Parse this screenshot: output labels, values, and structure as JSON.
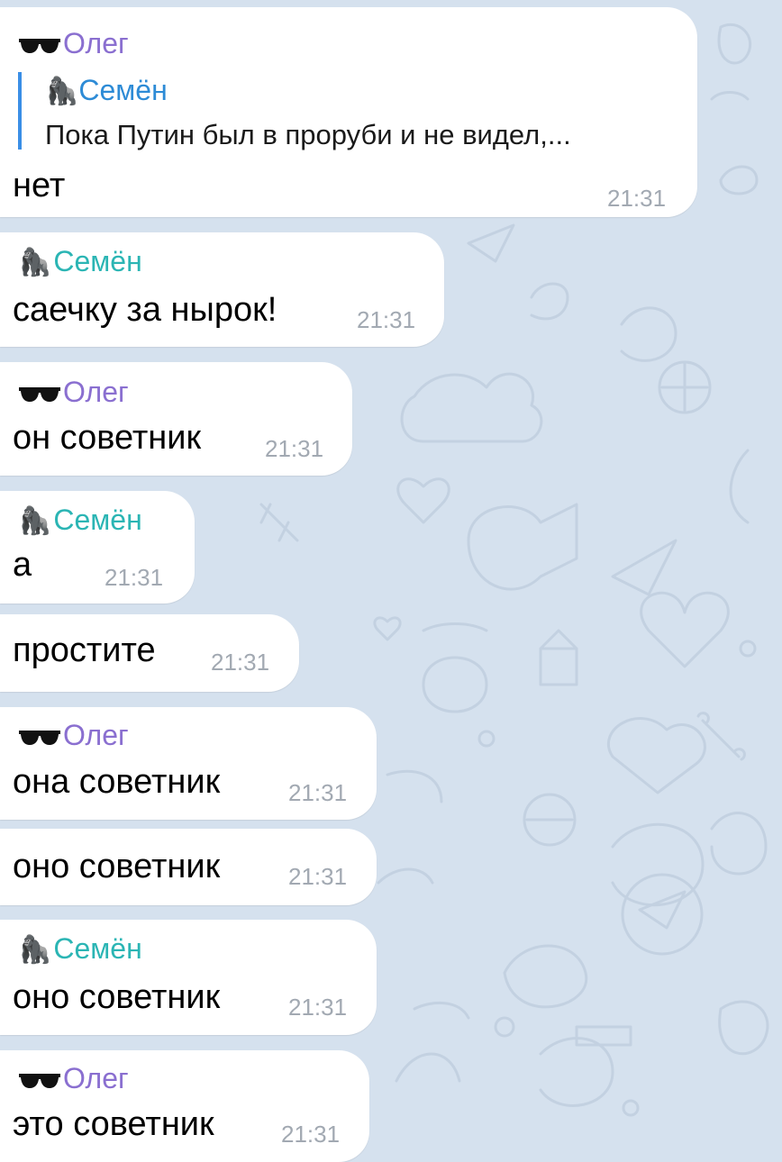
{
  "colors": {
    "background": "#d5e1ee",
    "bubble": "#ffffff",
    "oleg_name": "#8a6fd0",
    "semen_name": "#2bb5b4",
    "reply_name": "#2d8bd6",
    "reply_bar": "#3a8ee6",
    "timestamp": "#a2a9b2"
  },
  "icons": {
    "oleg": "sunglasses-icon",
    "semen": "gorilla-icon",
    "semen_glyph": "🦍"
  },
  "messages": [
    {
      "sender": "Олег",
      "reply": {
        "name": "Семён",
        "text": "Пока Путин был в проруби и не видел,..."
      },
      "text": "нет",
      "time": "21:31"
    },
    {
      "sender": "Семён",
      "text": "саечку за нырок!",
      "time": "21:31"
    },
    {
      "sender": "Олег",
      "text": "он советник",
      "time": "21:31"
    },
    {
      "sender": "Семён",
      "text": "а",
      "time": "21:31"
    },
    {
      "sender": "",
      "text": "простите",
      "time": "21:31"
    },
    {
      "sender": "Олег",
      "text": "она советник",
      "time": "21:31"
    },
    {
      "sender": "",
      "text": "оно советник",
      "time": "21:31"
    },
    {
      "sender": "Семён",
      "text": "оно советник",
      "time": "21:31"
    },
    {
      "sender": "Олег",
      "text": "это советник",
      "time": "21:31"
    }
  ]
}
